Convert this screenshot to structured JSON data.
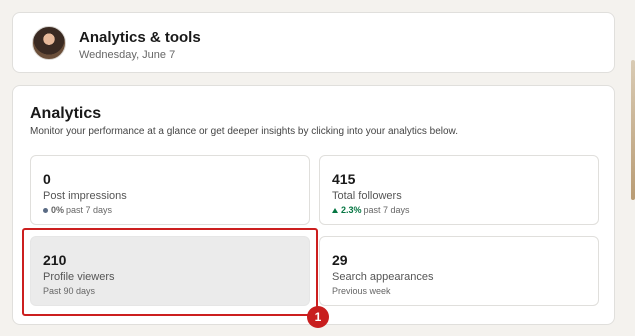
{
  "header": {
    "title": "Analytics & tools",
    "date": "Wednesday, June 7"
  },
  "analytics": {
    "title": "Analytics",
    "description": "Monitor your performance at a glance or get deeper insights by clicking into your analytics below.",
    "tiles": [
      {
        "value": "0",
        "label": "Post impressions",
        "change": "0%",
        "period": "past 7 days",
        "trend_icon": "neutral-dot-icon"
      },
      {
        "value": "415",
        "label": "Total followers",
        "change": "2.3%",
        "period": "past 7 days",
        "trend_icon": "trend-up-icon"
      },
      {
        "value": "210",
        "label": "Profile viewers",
        "period": "Past 90 days"
      },
      {
        "value": "29",
        "label": "Search appearances",
        "period": "Previous week"
      }
    ]
  },
  "annotation": {
    "marker": "1",
    "color": "#cc1f1f"
  },
  "colors": {
    "positive": "#057642",
    "neutral": "#5a6b84"
  }
}
